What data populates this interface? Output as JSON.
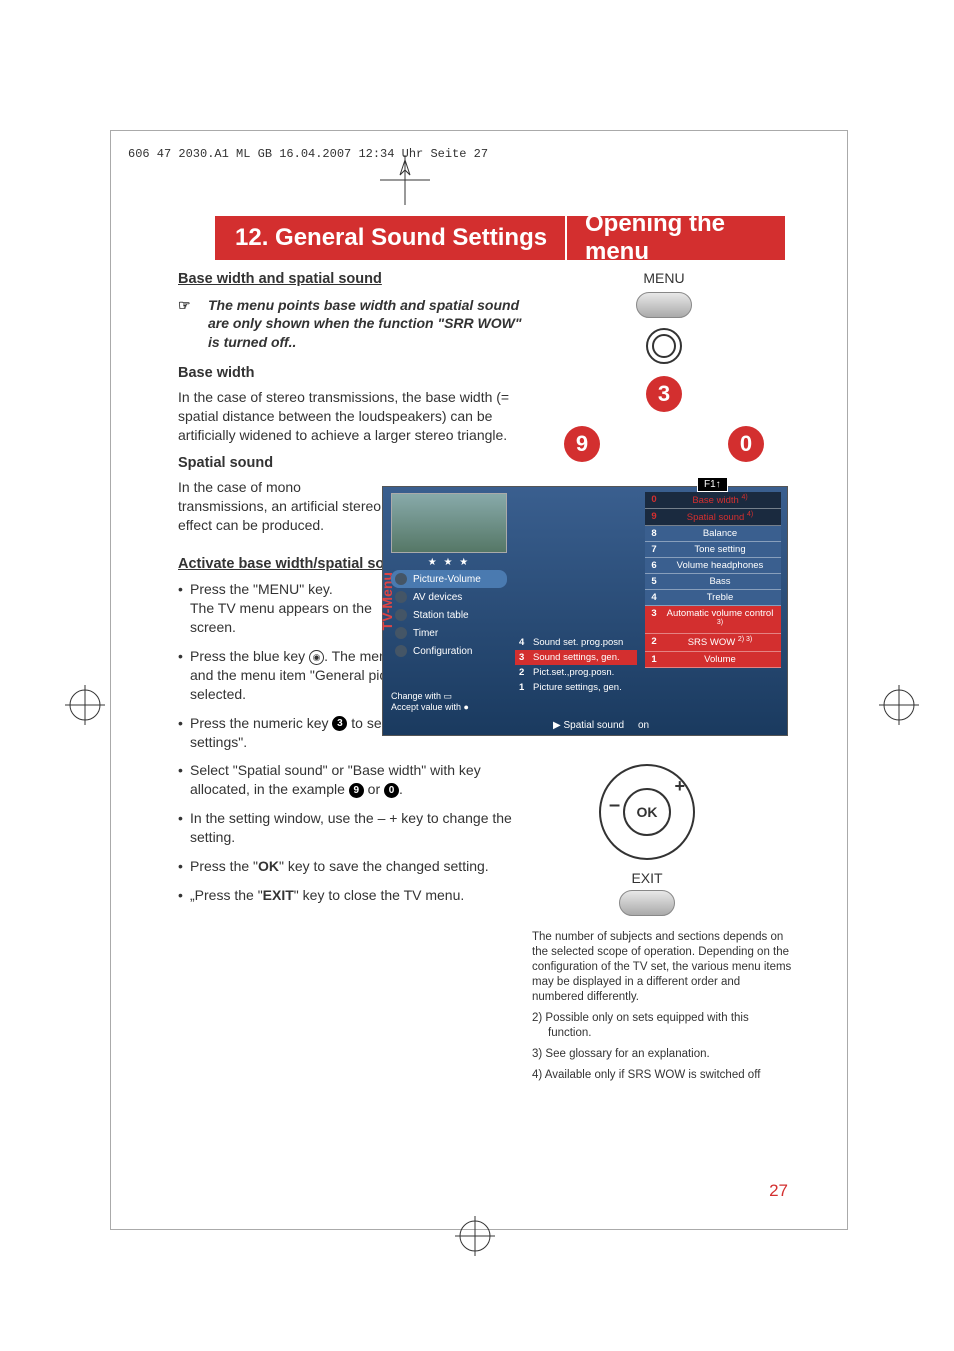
{
  "print_header": "606 47 2030.A1  ML GB  16.04.2007  12:34 Uhr  Seite 27",
  "title": {
    "chapter": "12. General Sound Settings",
    "section": "Opening the menu"
  },
  "left": {
    "h1": "Base width and spatial sound",
    "note": "The menu points base width and spatial sound are only shown when the function \"SRR WOW\" is turned off..",
    "sub1": "Base width",
    "p1": "In the case of stereo transmissions, the base width (= spatial distance between the loudspeakers) can be artificially widened to achieve a larger stereo triangle.",
    "sub2": "Spatial sound",
    "p2": "In the case of mono transmissions, an artificial stereo effect can be produced.",
    "h2": "Activate base width/spatial sound:",
    "li1a": "Press the \"MENU\" key.",
    "li1b": "The TV menu appears on the screen.",
    "li2a": "Press the blue key ",
    "li2b": ". The menu \"Picture and sound\" and the menu item \"General picture settings\" are pre-selected.",
    "li3a": "Press the numeric key ",
    "li3b": " to select \"General sound settings\".",
    "li4a": "Select \"Spatial sound\" or \"Base width\" with key allocated, in the example ",
    "li4b": " or ",
    "li5": "In the setting window, use the – + key to change the setting.",
    "li6a": "Press the \"",
    "li6b": "OK",
    "li6c": "\" key to save the changed setting.",
    "li7a": "„Press the \"",
    "li7b": "EXIT",
    "li7c": "\" key to close the TV menu."
  },
  "menu_label": "MENU",
  "exit_label": "EXIT",
  "ok_label": "OK",
  "nums": {
    "n3": "3",
    "n9": "9",
    "n0": "0"
  },
  "tv": {
    "vertical": "TV-Menu",
    "stars": "★ ★ ★",
    "col1": [
      {
        "label": "Picture-Volume",
        "hl": true
      },
      {
        "label": "AV devices",
        "hl": false
      },
      {
        "label": "Station table",
        "hl": false
      },
      {
        "label": "Timer",
        "hl": false
      },
      {
        "label": "Configuration",
        "hl": false
      }
    ],
    "col2": [
      {
        "n": "4",
        "t": "Sound set. prog.posn",
        "sel": false
      },
      {
        "n": "3",
        "t": "Sound settings, gen.",
        "sel": true
      },
      {
        "n": "2",
        "t": "Pict.set.,prog.posn.",
        "sel": false
      },
      {
        "n": "1",
        "t": "Picture settings, gen.",
        "sel": false
      }
    ],
    "f1": "F1↑",
    "col3": [
      {
        "n": "0",
        "t": "Base width",
        "sup": "4)",
        "dark": true
      },
      {
        "n": "9",
        "t": "Spatial sound",
        "sup": "4)",
        "dark": true
      },
      {
        "n": "8",
        "t": "Balance"
      },
      {
        "n": "7",
        "t": "Tone setting"
      },
      {
        "n": "6",
        "t": "Volume headphones"
      },
      {
        "n": "5",
        "t": "Bass"
      },
      {
        "n": "4",
        "t": "Treble"
      },
      {
        "n": "3",
        "t": "Automatic volume control",
        "sup": "3)",
        "red": true
      },
      {
        "n": "2",
        "t": "SRS WOW",
        "sup": "2) 3)",
        "red": true
      },
      {
        "n": "1",
        "t": "Volume",
        "red": true
      }
    ],
    "footer1": "Change with",
    "footer2": "Accept value with",
    "spatial": "Spatial sound",
    "spatial_val": "on"
  },
  "footnotes": {
    "main": "The number of subjects and sections depends on the selected scope of operation. Depending on the configuration of the TV set, the various menu items may be displayed in a different order and numbered differently.",
    "f2": "2) Possible only on sets equipped with this function.",
    "f3": "3) See glossary for an explanation.",
    "f4": "4) Available only if SRS WOW is switched off"
  },
  "page_num": "27"
}
